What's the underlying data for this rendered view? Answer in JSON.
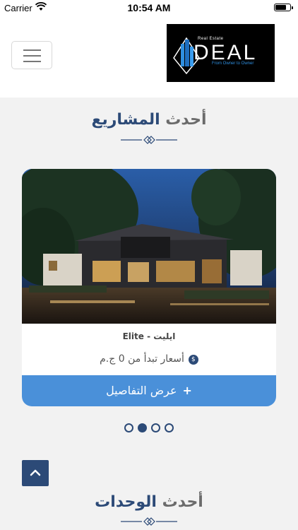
{
  "status_bar": {
    "carrier": "Carrier",
    "time": "10:54 AM",
    "wifi_icon": "wifi-icon",
    "battery_icon": "battery-icon"
  },
  "header": {
    "menu_icon": "hamburger-menu-icon",
    "logo": {
      "small_text": "Real Estate",
      "main_text": "DEAL",
      "tagline": "From Owner to Owner"
    }
  },
  "projects_section": {
    "title_part1": "أحدث",
    "title_part2": "المشاريع"
  },
  "project_card": {
    "name": "Elite - ايليت",
    "price": "أسعار تبدأ من 0 ج.م",
    "price_icon_glyph": "$",
    "details_label": "عرض التفاصيل",
    "details_icon_glyph": "+"
  },
  "carousel": {
    "total_pages": 4,
    "active_index": 1
  },
  "scroll_top_icon": "chevron-up-icon",
  "units_section": {
    "title_part1": "أحدث",
    "title_part2": "الوحدات"
  },
  "colors": {
    "primary_navy": "#2c4a77",
    "button_blue": "#4a90d9",
    "background": "#f2f2f2"
  }
}
